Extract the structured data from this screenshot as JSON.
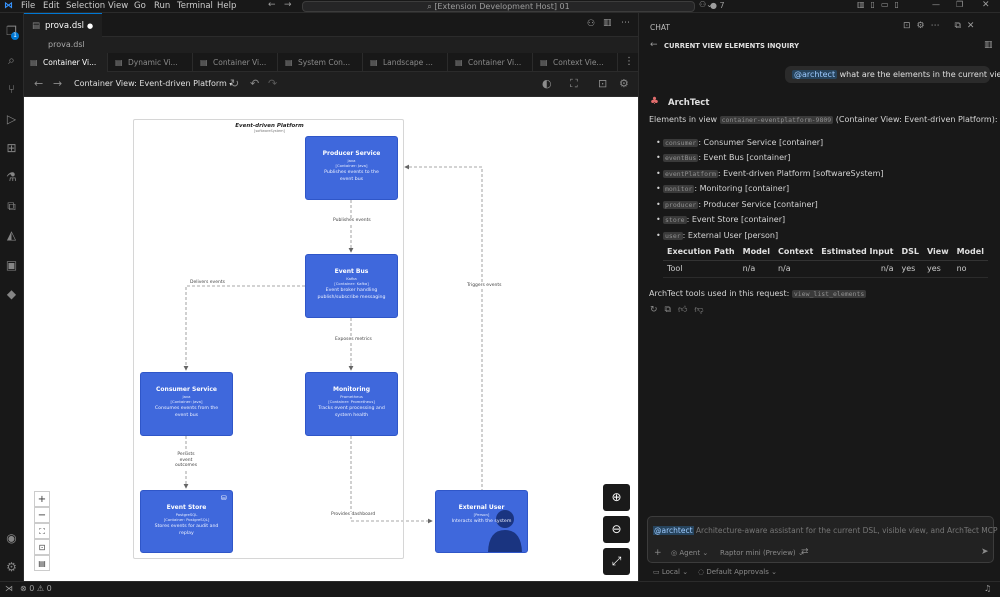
{
  "menu": [
    "File",
    "Edit",
    "Selection",
    "View",
    "Go",
    "Run",
    "Terminal",
    "Help"
  ],
  "command_center": "[Extension Development Host] 01",
  "title_badge": "7",
  "activity_badge": "1",
  "editor": {
    "tab_title": "prova.dsl",
    "breadcrumb": "prova.dsl",
    "arch_tabs": [
      "Container Vi...",
      "Dynamic Vi...",
      "Container Vi...",
      "System Con...",
      "Landscape ...",
      "Container Vi...",
      "Context Vie..."
    ],
    "view_selector": "Container View: Event-driven Platform"
  },
  "diagram": {
    "system_title": "Event-driven Platform",
    "system_subtitle": "[softwareSystem]",
    "nodes": {
      "producer": {
        "name": "Producer Service",
        "tech": "Java",
        "type": "[Container: Java]",
        "desc": "Publishes events to the event bus"
      },
      "bus": {
        "name": "Event Bus",
        "tech": "Kafka",
        "type": "[Container: Kafka]",
        "desc": "Event broker handling publish/subscribe messaging"
      },
      "consumer": {
        "name": "Consumer Service",
        "tech": "Java",
        "type": "[Container: Java]",
        "desc": "Consumes events from the event bus"
      },
      "monitoring": {
        "name": "Monitoring",
        "tech": "Prometheus",
        "type": "[Container: Prometheus]",
        "desc": "Tracks event processing and system health"
      },
      "store": {
        "name": "Event Store",
        "tech": "PostgreSQL",
        "type": "[Container: PostgreSQL]",
        "desc": "Stores events for audit and replay"
      },
      "user": {
        "name": "External User",
        "type": "[Person]",
        "desc": "Interacts with the system"
      }
    },
    "edges": {
      "publishes": "Publishes events",
      "delivers": "Delivers events",
      "triggers": "Triggers events",
      "exposes": "Exposes metrics",
      "persists": "Persists event outcomes",
      "dashboard": "Provides dashboard"
    }
  },
  "chat": {
    "header": "CHAT",
    "subheader": "CURRENT VIEW ELEMENTS INQUIRY",
    "user_mention": "@archtect",
    "user_question": "what are the elements in the current view ?",
    "agent_name": "ArchTect",
    "intro_pre": "Elements in view",
    "intro_code": "container-eventplatform-9809",
    "intro_post": "(Container View: Event-driven Platform): 7",
    "elements": [
      {
        "id": "consumer",
        "text": ": Consumer Service [container]"
      },
      {
        "id": "eventBus",
        "text": ": Event Bus [container]"
      },
      {
        "id": "eventPlatform",
        "text": ": Event-driven Platform [softwareSystem]"
      },
      {
        "id": "monitor",
        "text": ": Monitoring [container]"
      },
      {
        "id": "producer",
        "text": ": Producer Service [container]"
      },
      {
        "id": "store",
        "text": ": Event Store [container]"
      },
      {
        "id": "user",
        "text": ": External User [person]"
      }
    ],
    "table_headers": [
      "Execution Path",
      "Model",
      "Context",
      "Estimated Input",
      "DSL",
      "View",
      "Model"
    ],
    "table_row": [
      "Tool",
      "n/a",
      "n/a",
      "n/a",
      "yes",
      "yes",
      "no"
    ],
    "tools_used_label": "ArchTect tools used in this request:",
    "tools_used_code": "view_list_elements",
    "input_mention": "@archtect",
    "input_placeholder": "Architecture-aware assistant for the current DSL, visible view, and ArchTect MCP tools",
    "mode": "Agent",
    "model": "Raptor mini (Preview)",
    "location": "Local",
    "approvals": "Default Approvals"
  },
  "status": {
    "errors": "0",
    "warnings": "0"
  }
}
